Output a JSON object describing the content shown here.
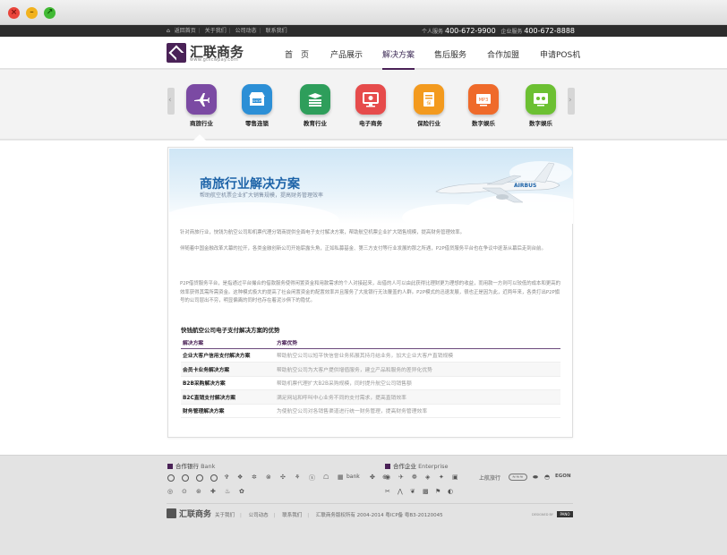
{
  "window": {
    "close": "×",
    "minimize": "–",
    "maximize": "↗"
  },
  "topbar": {
    "links": [
      "返回首页",
      "关于我们",
      "公司动态",
      "联系我们"
    ],
    "phone1_label": "个人服务",
    "phone1": "400-672-9900",
    "phone2_label": "企业服务",
    "phone2": "400-672-8888"
  },
  "brand": {
    "name": "汇联商务",
    "url": "www.gtlicwpay.com"
  },
  "nav": {
    "items": [
      "首　页",
      "产品展示",
      "解决方案",
      "售后服务",
      "合作加盟",
      "申请POS机"
    ],
    "active_index": 2
  },
  "categories": [
    {
      "label": "商旅行业",
      "color": "#7b4aa3",
      "icon": "plane-icon"
    },
    {
      "label": "零售连锁",
      "color": "#2c8fd6",
      "icon": "shop-icon"
    },
    {
      "label": "教育行业",
      "color": "#2e9e5b",
      "icon": "book-icon"
    },
    {
      "label": "电子商务",
      "color": "#e64b4b",
      "icon": "monitor-icon"
    },
    {
      "label": "保险行业",
      "color": "#f39a1e",
      "icon": "insurance-icon"
    },
    {
      "label": "数字娱乐",
      "color": "#ef6a2a",
      "icon": "media-icon"
    },
    {
      "label": "数字娱乐",
      "color": "#6cc032",
      "icon": "game-icon"
    }
  ],
  "banner": {
    "title": "商旅行业解决方案",
    "subtitle": "帮助航空机票企业扩大销售规模，提高财务管理效率"
  },
  "body": {
    "p1": "针对商旅行业，快钱为航空公司和机票代理分销商提供全面电子支付解决方案，帮助航空机票企业扩大销售规模，提高财务管理效率。",
    "p2": "伴随着中国金融改革大幕的拉开，各类金融创新公司开始崭露头角，正如私募基金、第三方支付等行业发展的那之所遇，P2P借贷服务平台也在争议中逐渐从幕后走到台前。",
    "p3": "P2P借贷服务平台，是指通过平台撮合的借款服务使得闲置资金和用款需求的个人对接起来，出借的人可以由此获得比理财更为理想的收益，而用款一方则可以较低的成本和更高的效率获得其需所需资金。这种模式极大的提高了社会闲置资金的配置效率并且服务了大批银行无法覆盖的人群。P2P模式的迅速发展，很也正是因为此，近两年来，各类打出P2P旗号的公司层出不穷，明显偏离的同时也存在着泥沙俱下的隐忧。"
  },
  "section_title": "快钱航空公司电子支付解决方案的优势",
  "table": {
    "headers": [
      "解决方案",
      "方案优势"
    ],
    "rows": [
      [
        "企业大客户信用支付解决方案",
        "帮助航空公司以短平快信誉业务拓展其持月结业务，加大企业大客户直销规模"
      ],
      [
        "会员卡业务解决方案",
        "帮助航空公司为大客户提供增值服务，建立产品和服务的差异化优势"
      ],
      [
        "B2B采购解决方案",
        "帮助机票代理扩大B2B采购规模，同时提升航空公司销售额"
      ],
      [
        "B2C直销支付解决方案",
        "满足网站和呼叫中心业务不同的支付需求，提高直销效率"
      ],
      [
        "财务管理解决方案",
        "为使航空公司对各销售渠道进行统一财务管理，提高财务管理效率"
      ]
    ]
  },
  "footer": {
    "banks_title": "合作银行",
    "banks_title_en": "Bank",
    "partners_title": "合作企业",
    "partners_title_en": "Enterprise",
    "bank_logos": [
      "ICBC",
      "ABC",
      "CCB",
      "BOC",
      "BOCOM",
      "CMB",
      "CITIC",
      "SPDB",
      "CIB",
      "CMBC",
      "CEB",
      "HXB",
      "bank",
      "PAB",
      "BCCB",
      "GDB"
    ],
    "partner_logos": [
      "CA",
      "CZ",
      "MU",
      "HU",
      "CTRIP",
      "ELONG",
      "上航旅行",
      "17U",
      "QUNAR",
      "EGON",
      "UNION",
      "ZJ",
      "ZH",
      "MF",
      "3U",
      "SC",
      "KN",
      "FM"
    ],
    "partner_text_1": "上航旅行",
    "partner_text_2": "EGON",
    "brand": "汇联商务",
    "links": [
      "关于我们",
      "公司动态",
      "联系我们"
    ],
    "copyright": "汇联商务版权所有 2004-2014 粤ICP备 粤B3-20120045",
    "powered_label": "DESIGNED BY",
    "powered_badge": "PANO"
  }
}
